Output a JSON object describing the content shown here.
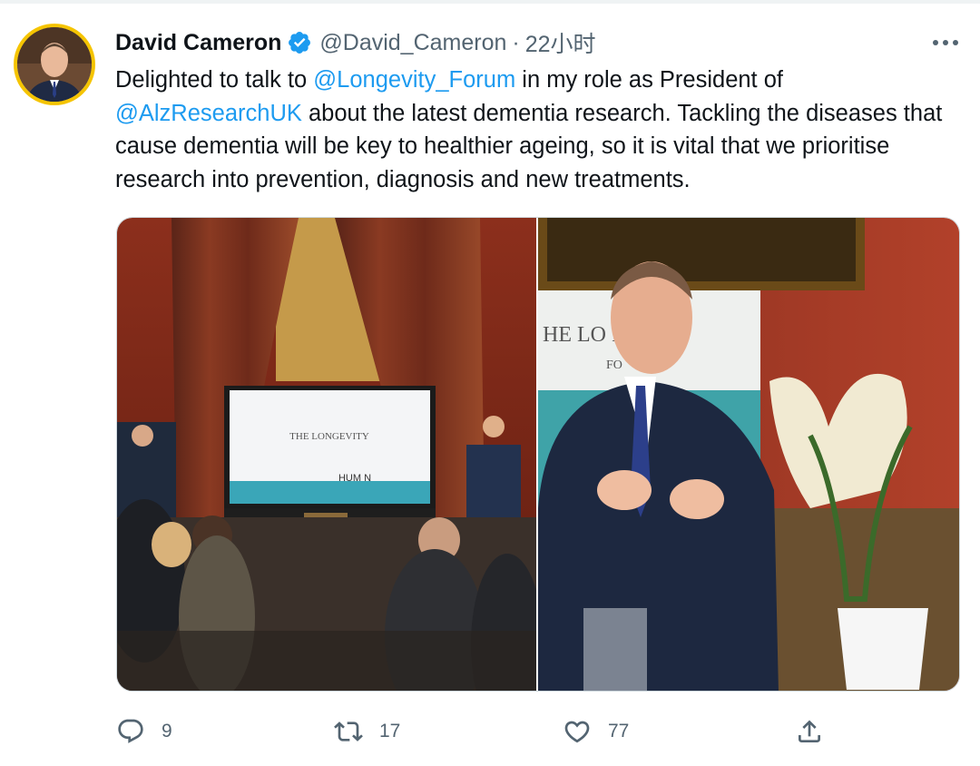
{
  "tweet": {
    "author": {
      "name": "David Cameron",
      "handle": "@David_Cameron",
      "separator": "·",
      "time": "22小时",
      "verified_icon": "verified-badge-icon"
    },
    "text": {
      "p1": "Delighted to talk to ",
      "mention1": "@Longevity_Forum",
      "p2": " in my role as President of ",
      "mention2": "@AlzResearchUK",
      "p3": " about the latest dementia research. Tackling the diseases that cause dementia will be key to healthier ageing, so it is vital that we prioritise research into prevention, diagnosis and new treatments."
    },
    "media": {
      "left_screen_title": "THE LONGEVITY",
      "left_screen_logo": "HUM N",
      "right_banner_line1": "HE LO      ITY",
      "right_banner_line2": "FO"
    },
    "actions": {
      "reply_count": "9",
      "retweet_count": "17",
      "like_count": "77"
    }
  },
  "colors": {
    "accent": "#1d9bf0",
    "secondary_text": "#536471",
    "primary_text": "#0f1419"
  }
}
